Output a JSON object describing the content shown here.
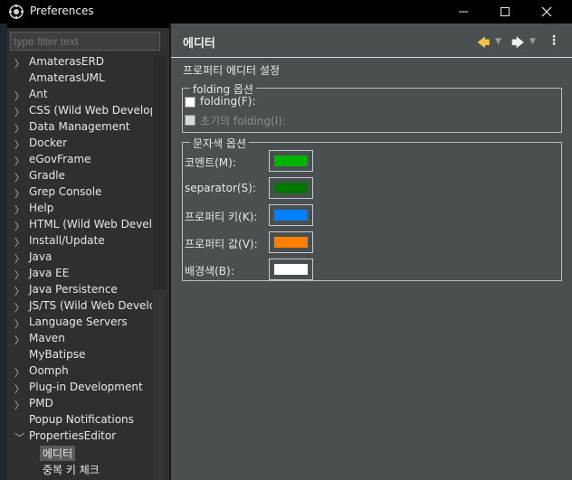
{
  "window": {
    "title": "Preferences"
  },
  "filter": {
    "placeholder": "type filter text"
  },
  "tree": [
    {
      "label": "AmaterasERD",
      "expandable": true
    },
    {
      "label": "AmaterasUML",
      "expandable": false
    },
    {
      "label": "Ant",
      "expandable": true
    },
    {
      "label": "CSS (Wild Web Develop",
      "expandable": true
    },
    {
      "label": "Data Management",
      "expandable": true
    },
    {
      "label": "Docker",
      "expandable": true
    },
    {
      "label": "eGovFrame",
      "expandable": true
    },
    {
      "label": "Gradle",
      "expandable": true
    },
    {
      "label": "Grep Console",
      "expandable": true
    },
    {
      "label": "Help",
      "expandable": true
    },
    {
      "label": "HTML (Wild Web Develo",
      "expandable": true
    },
    {
      "label": "Install/Update",
      "expandable": true
    },
    {
      "label": "Java",
      "expandable": true
    },
    {
      "label": "Java EE",
      "expandable": true
    },
    {
      "label": "Java Persistence",
      "expandable": true
    },
    {
      "label": "JS/TS (Wild Web Develo",
      "expandable": true
    },
    {
      "label": "Language Servers",
      "expandable": true
    },
    {
      "label": "Maven",
      "expandable": true
    },
    {
      "label": "MyBatipse",
      "expandable": false
    },
    {
      "label": "Oomph",
      "expandable": true
    },
    {
      "label": "Plug-in Development",
      "expandable": true
    },
    {
      "label": "PMD",
      "expandable": true
    },
    {
      "label": "Popup Notifications",
      "expandable": false
    },
    {
      "label": "PropertiesEditor",
      "expandable": true,
      "expanded": true
    }
  ],
  "tree_children": [
    {
      "label": "에디터",
      "selected": true
    },
    {
      "label": "중복 키 체크",
      "selected": false
    }
  ],
  "page": {
    "title": "에디터",
    "description": "프로퍼티 에디터 설정",
    "folding_group": {
      "legend": "folding 옵션",
      "options": [
        {
          "label": "folding(F):",
          "checked": false,
          "enabled": true
        },
        {
          "label": "초기의 folding(I):",
          "checked": false,
          "enabled": false
        }
      ]
    },
    "color_group": {
      "legend": "문자색 옵션",
      "items": [
        {
          "label": "코멘트(M):",
          "color": "#00b400"
        },
        {
          "label": "separator(S):",
          "color": "#007800"
        },
        {
          "label": "프로퍼티 키(K):",
          "color": "#0080ff"
        },
        {
          "label": "프로퍼티 값(V):",
          "color": "#ff8000"
        },
        {
          "label": "배경색(B):",
          "color": "#ffffff"
        }
      ]
    }
  }
}
